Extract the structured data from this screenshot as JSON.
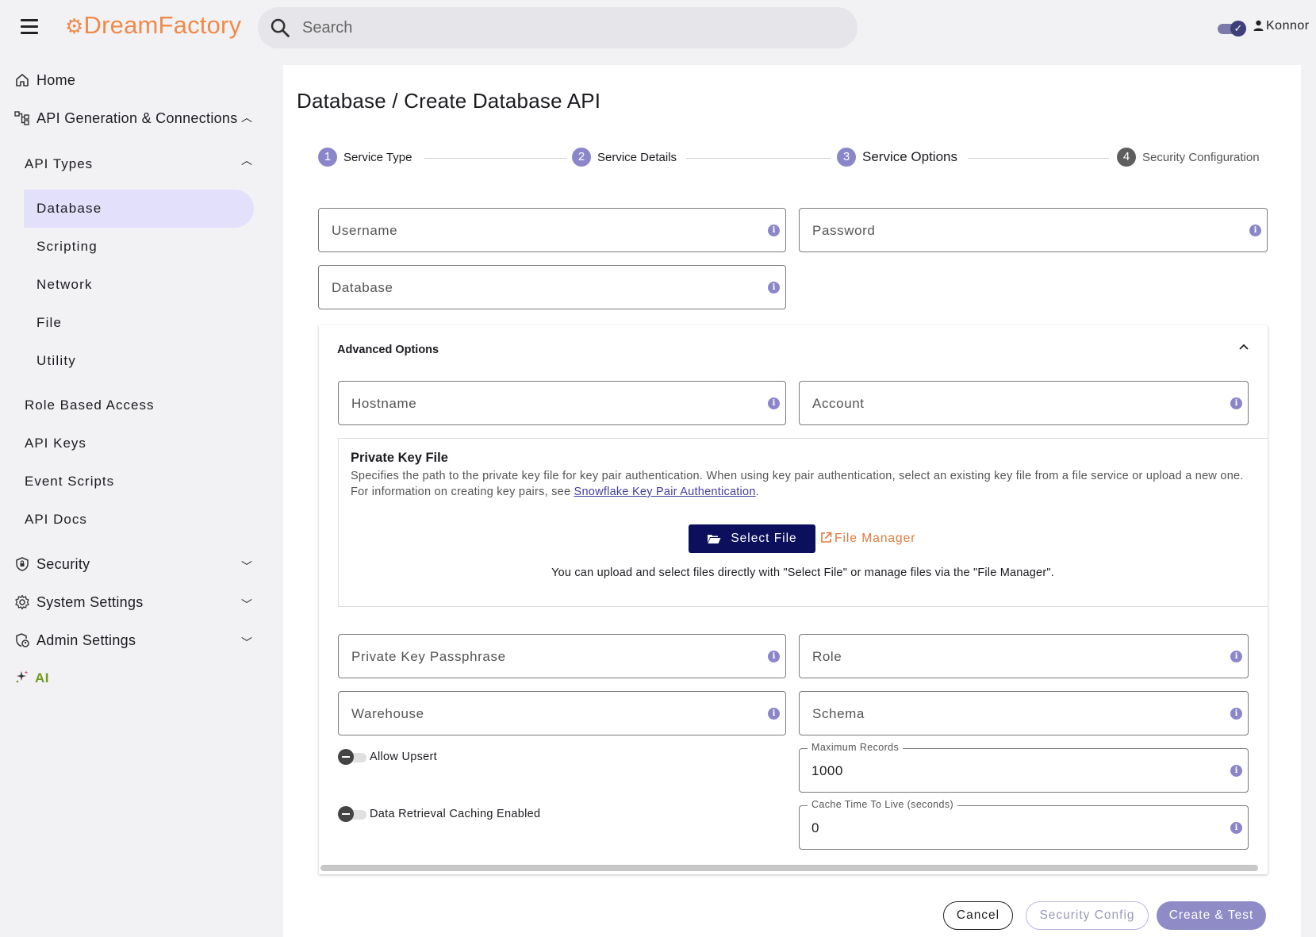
{
  "app": {
    "logo_text": "DreamFactory",
    "search_placeholder": "Search",
    "user_name": "Konnor",
    "accent_color": "#8a86c9",
    "brand_color": "#f08a4b"
  },
  "sidebar": {
    "home": "Home",
    "api_gen": "API Generation & Connections",
    "api_types": "API Types",
    "types": [
      "Database",
      "Scripting",
      "Network",
      "File",
      "Utility"
    ],
    "active_type": "Database",
    "sections": [
      "Role Based Access",
      "API Keys",
      "Event Scripts",
      "API Docs"
    ],
    "security": "Security",
    "system_settings": "System Settings",
    "admin_settings": "Admin Settings",
    "ai": "AI"
  },
  "page": {
    "title": "Database / Create Database API"
  },
  "stepper": [
    {
      "num": "1",
      "label": "Service Type"
    },
    {
      "num": "2",
      "label": "Service Details"
    },
    {
      "num": "3",
      "label": "Service Options"
    },
    {
      "num": "4",
      "label": "Security Configuration"
    }
  ],
  "fields": {
    "username": "Username",
    "password": "Password",
    "database": "Database"
  },
  "advanced": {
    "title": "Advanced Options",
    "hostname": "Hostname",
    "account": "Account",
    "private_key": {
      "title": "Private Key File",
      "desc_before": "Specifies the path to the private key file for key pair authentication. When using key pair authentication, select an existing key file from a file service or upload a new one. For information on creating key pairs, see ",
      "link_text": "Snowflake Key Pair Authentication",
      "desc_after": ".",
      "select_file": "Select File",
      "file_manager": "File Manager",
      "note": "You can upload and select files directly with \"Select File\" or manage files via the \"File Manager\"."
    },
    "private_key_passphrase": "Private Key Passphrase",
    "role": "Role",
    "warehouse": "Warehouse",
    "schema": "Schema",
    "allow_upsert": "Allow Upsert",
    "caching_enabled": "Data Retrieval Caching Enabled",
    "max_records_label": "Maximum Records",
    "max_records_value": "1000",
    "cache_ttl_label": "Cache Time To Live (seconds)",
    "cache_ttl_value": "0"
  },
  "buttons": {
    "cancel": "Cancel",
    "security_config": "Security Config",
    "create_test": "Create & Test"
  }
}
